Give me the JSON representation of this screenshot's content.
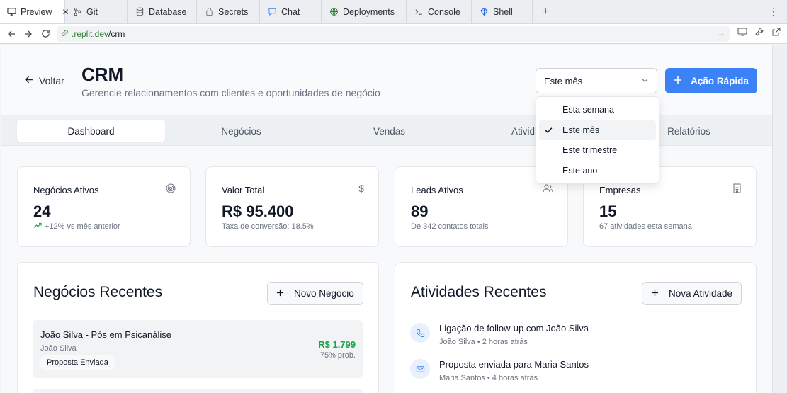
{
  "browser": {
    "tabs": [
      {
        "label": "Preview",
        "icon": "monitor-icon",
        "active": true
      },
      {
        "label": "Git",
        "icon": "git-icon"
      },
      {
        "label": "Database",
        "icon": "database-icon"
      },
      {
        "label": "Secrets",
        "icon": "lock-icon"
      },
      {
        "label": "Chat",
        "icon": "chat-icon"
      },
      {
        "label": "Deployments",
        "icon": "globe-icon"
      },
      {
        "label": "Console",
        "icon": "terminal-icon"
      },
      {
        "label": "Shell",
        "icon": "shell-icon"
      }
    ],
    "url_host": ".replit.dev",
    "url_path": "/crm"
  },
  "header": {
    "back_label": "Voltar",
    "title": "CRM",
    "subtitle": "Gerencie relacionamentos com clientes e oportunidades de negócio",
    "period_selected": "Este mês",
    "quick_action_label": "Ação Rápida"
  },
  "period_menu": {
    "options": [
      "Esta semana",
      "Este mês",
      "Este trimestre",
      "Este ano"
    ],
    "selected_index": 1
  },
  "tabs": [
    "Dashboard",
    "Negócios",
    "Vendas",
    "Ativid",
    "Relatórios"
  ],
  "stats": [
    {
      "label": "Negócios Ativos",
      "value": "24",
      "sub": "+12% vs mês anterior",
      "icon": "target-icon"
    },
    {
      "label": "Valor Total",
      "value": "R$ 95.400",
      "sub": "Taxa de conversão: 18.5%",
      "icon": "dollar-icon"
    },
    {
      "label": "Leads Ativos",
      "value": "89",
      "sub": "De 342 contatos totais",
      "icon": "users-icon"
    },
    {
      "label": "Empresas",
      "value": "15",
      "sub": "67 atividades esta semana",
      "icon": "building-icon"
    }
  ],
  "deals_panel": {
    "title": "Negócios Recentes",
    "button_label": "Novo Negócio",
    "items": [
      {
        "title": "João Silva - Pós em Psicanálise",
        "client": "João Silva",
        "status": "Proposta Enviada",
        "value": "R$ 1.799",
        "prob": "75% prob."
      }
    ]
  },
  "activities_panel": {
    "title": "Atividades Recentes",
    "button_label": "Nova Atividade",
    "items": [
      {
        "title": "Ligação de follow-up com João Silva",
        "meta": "João Silva • 2 horas atrás",
        "icon": "phone-icon"
      },
      {
        "title": "Proposta enviada para Maria Santos",
        "meta": "Maria Santos • 4 horas atrás",
        "icon": "mail-icon"
      }
    ]
  },
  "colors": {
    "accent": "#3b82f6",
    "success": "#16a34a"
  }
}
